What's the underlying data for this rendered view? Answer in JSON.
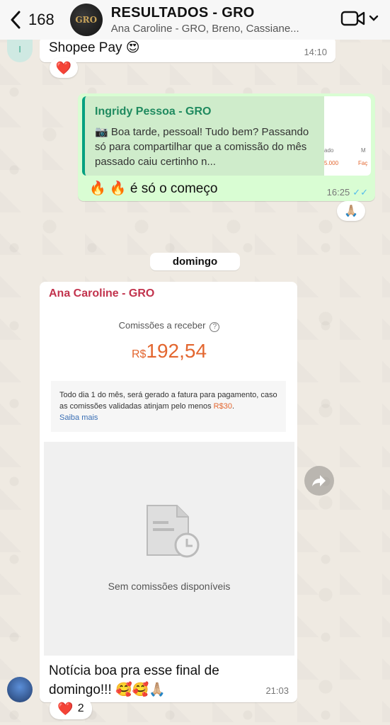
{
  "header": {
    "back_count": "168",
    "group_avatar_text": "GRO",
    "title": "RESULTADOS - GRO",
    "subtitle": "Ana Caroline - GRO, Breno, Cassiane..."
  },
  "messages": {
    "top": {
      "sender_initial": "I",
      "text": "Shopee Pay 😍",
      "time": "14:10",
      "reaction": "❤️"
    },
    "outgoing": {
      "quote_name": "Ingridy Pessoa - GRO",
      "quote_text": "📷 Boa tarde, pessoal! Tudo bem? Passando só para compartilhar que a comissão do mês passado caiu certinho n...",
      "thumb_a": "ado",
      "thumb_b": "5.000",
      "thumb_c": "M",
      "thumb_d": "Faç",
      "text": "🔥 🔥 é só o começo",
      "time": "16:25",
      "ticks": "✓✓",
      "reaction": "🙏🏼"
    },
    "date_divider": "domingo",
    "incoming": {
      "sender": "Ana Caroline - GRO",
      "screenshot": {
        "label": "Comissões a receber",
        "help": "?",
        "currency": "R$",
        "amount": "192,54",
        "info_text": "Todo dia 1 do mês, será gerado a fatura para pagamento, caso as comissões validadas atinjam pelo menos",
        "info_amount": "R$30",
        "info_end": ".",
        "info_link": "Saiba mais",
        "empty_text": "Sem comissões disponíveis"
      },
      "text": "Notícia boa pra esse final de domingo!!! 🥰🥰🙏🏼",
      "time": "21:03",
      "reaction_emoji": "❤️",
      "reaction_count": "2"
    }
  },
  "colors": {
    "accent_green": "#06a080",
    "outgoing_bubble": "#d9fdd3",
    "sender_red": "#c2334d",
    "shopee_orange": "#e3662f",
    "read_ticks": "#53bdeb"
  },
  "icons": [
    "back-chevron-icon",
    "video-call-icon",
    "chevron-down-icon",
    "camera-icon",
    "help-icon",
    "document-clock-icon",
    "forward-icon"
  ]
}
